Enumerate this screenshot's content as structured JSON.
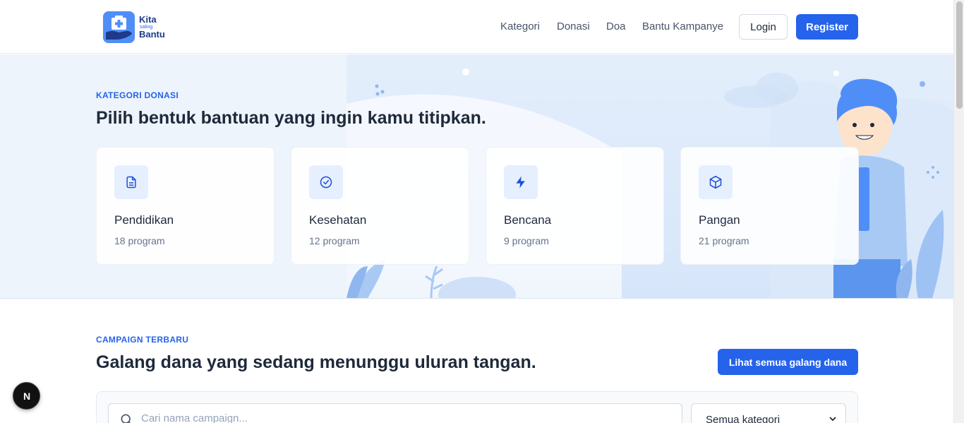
{
  "header": {
    "logo": {
      "line1": "Kita",
      "line2": "saling",
      "line3": "Bantu"
    },
    "nav": [
      {
        "label": "Kategori"
      },
      {
        "label": "Donasi"
      },
      {
        "label": "Doa"
      },
      {
        "label": "Bantu Kampanye"
      }
    ],
    "login_label": "Login",
    "register_label": "Register"
  },
  "categories_section": {
    "eyebrow": "KATEGORI DONASI",
    "title": "Pilih bentuk bantuan yang ingin kamu titipkan.",
    "cards": [
      {
        "name": "Pendidikan",
        "count": "18 program",
        "icon": "document-icon"
      },
      {
        "name": "Kesehatan",
        "count": "12 program",
        "icon": "check-circle-icon"
      },
      {
        "name": "Bencana",
        "count": "9 program",
        "icon": "lightning-icon"
      },
      {
        "name": "Pangan",
        "count": "21 program",
        "icon": "box-icon"
      }
    ]
  },
  "campaign_section": {
    "eyebrow": "CAMPAIGN TERBARU",
    "title": "Galang dana yang sedang menunggu uluran tangan.",
    "see_all_label": "Lihat semua galang dana",
    "search": {
      "placeholder": "Cari nama campaign...",
      "value": ""
    },
    "category_filter": {
      "selected": "Semua kategori"
    }
  },
  "dev_badge": {
    "letter": "N"
  },
  "colors": {
    "primary": "#2563eb",
    "hero_bg": "#eef4fc",
    "text_dark": "#1e293b",
    "text_muted": "#64748b"
  }
}
